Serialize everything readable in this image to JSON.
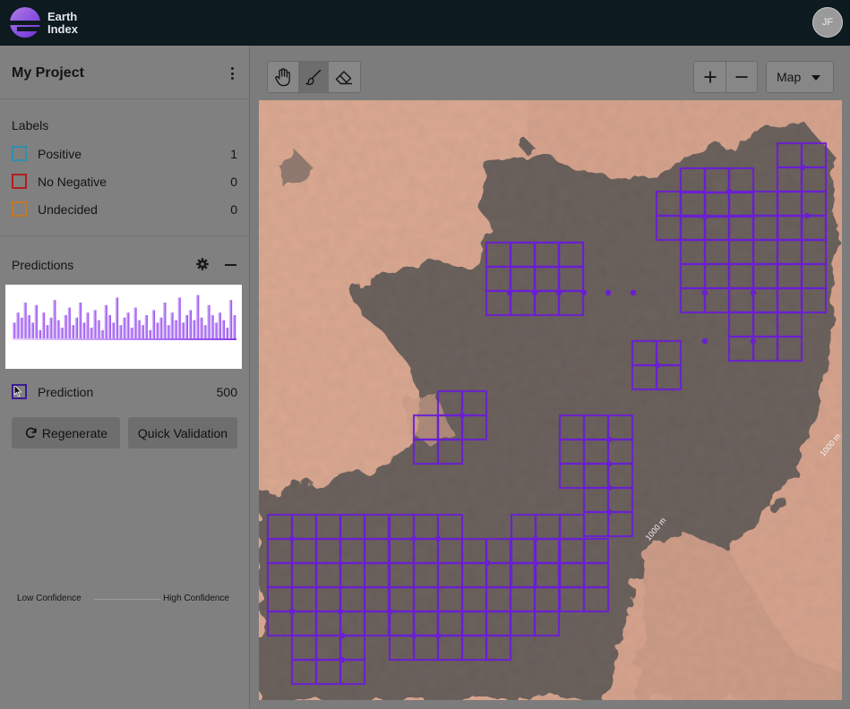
{
  "header": {
    "brand_line1": "Earth",
    "brand_line2": "Index",
    "user_initials": "JF"
  },
  "project": {
    "title": "My Project"
  },
  "labels": {
    "heading": "Labels",
    "items": [
      {
        "name": "Positive",
        "count": "1",
        "color": "#2e8fb0"
      },
      {
        "name": "No Negative",
        "count": "0",
        "color": "#b0201f"
      },
      {
        "name": "Undecided",
        "count": "0",
        "color": "#c07a25"
      }
    ]
  },
  "predictions": {
    "heading": "Predictions",
    "low_label": "Low Confidence",
    "high_label": "High Confidence",
    "prediction_label": "Prediction",
    "prediction_count": "500",
    "prediction_color": "#3a1a92",
    "regenerate_label": "Regenerate",
    "quick_validation_label": "Quick Validation",
    "histogram_levels": [
      0.35,
      0.55,
      0.45,
      0.75,
      0.5,
      0.35,
      0.7,
      0.2,
      0.55,
      0.3,
      0.45,
      0.8,
      0.4,
      0.25,
      0.5,
      0.65,
      0.3,
      0.45,
      0.75,
      0.35,
      0.55,
      0.25,
      0.6,
      0.4,
      0.2,
      0.7,
      0.5,
      0.35,
      0.85,
      0.3,
      0.45,
      0.55,
      0.25,
      0.65,
      0.4,
      0.3,
      0.5,
      0.2,
      0.6,
      0.35,
      0.45,
      0.75,
      0.3,
      0.55,
      0.4,
      0.85,
      0.35,
      0.5,
      0.6,
      0.4,
      0.9,
      0.45,
      0.3,
      0.7,
      0.5,
      0.35,
      0.55,
      0.4,
      0.25,
      0.8,
      0.5
    ]
  },
  "toolbar": {
    "map_type": "Map"
  },
  "map": {
    "scale_label_1": "1000 m",
    "scale_label_2": "1000 m",
    "grid_color": "#6a1fd1"
  },
  "icons": {
    "logo": "earth-index-logo",
    "menu": "kebab-icon",
    "settings": "gear-icon",
    "collapse": "minus-icon",
    "regenerate": "refresh-icon",
    "pan": "hand-icon",
    "brush": "brush-icon",
    "erase": "eraser-icon",
    "zoom_in": "plus-icon",
    "zoom_out": "minus-icon",
    "dropdown": "caret-down-icon",
    "pointer": "cursor-icon"
  }
}
